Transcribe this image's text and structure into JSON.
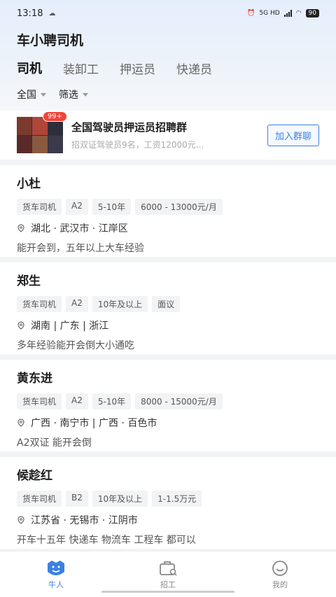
{
  "status": {
    "time": "13:18",
    "network": "5G HD",
    "battery": "90"
  },
  "app": {
    "title": "车小聘司机"
  },
  "tabs": [
    {
      "label": "司机",
      "active": true
    },
    {
      "label": "装卸工",
      "active": false
    },
    {
      "label": "押运员",
      "active": false
    },
    {
      "label": "快递员",
      "active": false
    }
  ],
  "filters": [
    {
      "label": "全国"
    },
    {
      "label": "筛选"
    }
  ],
  "banner": {
    "title": "全国驾驶员押运员招聘群",
    "subtitle": "招双证驾驶员9名，工资12000元...",
    "badge": "99+",
    "join_label": "加入群聊"
  },
  "cards": [
    {
      "name": "小杜",
      "tags": [
        "货车司机",
        "A2",
        "5-10年",
        "6000 - 13000元/月"
      ],
      "location": "湖北 · 武汉市 · 江岸区",
      "desc": "能开会到，五年以上大车经验"
    },
    {
      "name": "郑生",
      "tags": [
        "货车司机",
        "A2",
        "10年及以上",
        "面议"
      ],
      "location": "湖南  |  广东  |  浙江",
      "desc": "多年经验能开会倒大小通吃"
    },
    {
      "name": "黄东进",
      "tags": [
        "货车司机",
        "A2",
        "5-10年",
        "8000 - 15000元/月"
      ],
      "location": "广西 · 南宁市  |  广西 · 百色市",
      "desc": "A2双证 能开会倒"
    },
    {
      "name": "候趁红",
      "tags": [
        "货车司机",
        "B2",
        "10年及以上",
        "1-1.5万元"
      ],
      "location": "江苏省 · 无锡市 · 江阴市",
      "desc": "开车十五年 快递车 物流车 工程车 都可以"
    }
  ],
  "nav": [
    {
      "label": "牛人",
      "icon": "person-badge-icon",
      "active": true
    },
    {
      "label": "招工",
      "icon": "briefcase-search-icon",
      "active": false
    },
    {
      "label": "我的",
      "icon": "smiley-icon",
      "active": false
    }
  ],
  "colors": {
    "accent": "#3b82e0",
    "badge": "#f0443a"
  }
}
